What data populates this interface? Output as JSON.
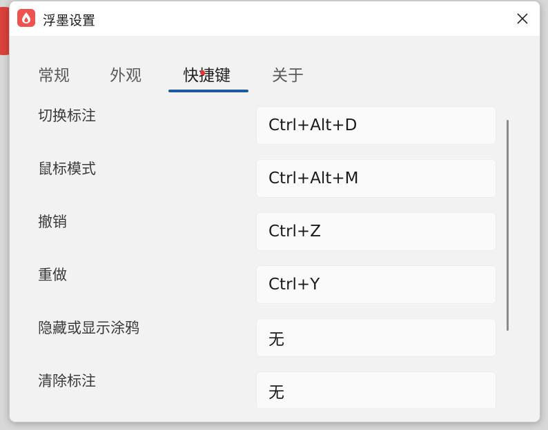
{
  "window": {
    "title": "浮墨设置"
  },
  "tabs": [
    {
      "label": "常规"
    },
    {
      "label": "外观"
    },
    {
      "label": "快捷键"
    },
    {
      "label": "关于"
    }
  ],
  "active_tab": "快捷键",
  "shortcuts": [
    {
      "label": "切换标注",
      "value": "Ctrl+Alt+D"
    },
    {
      "label": "鼠标模式",
      "value": "Ctrl+Alt+M"
    },
    {
      "label": "撤销",
      "value": "Ctrl+Z"
    },
    {
      "label": "重做",
      "value": "Ctrl+Y"
    },
    {
      "label": "隐藏或显示涂鸦",
      "value": "无"
    },
    {
      "label": "清除标注",
      "value": "无"
    }
  ],
  "colors": {
    "accent": "#1e5aa0",
    "app_icon": "#ef5350",
    "badge_dot": "#e53935"
  },
  "icons": {
    "app": "ink-drop-icon",
    "close": "close-icon"
  }
}
